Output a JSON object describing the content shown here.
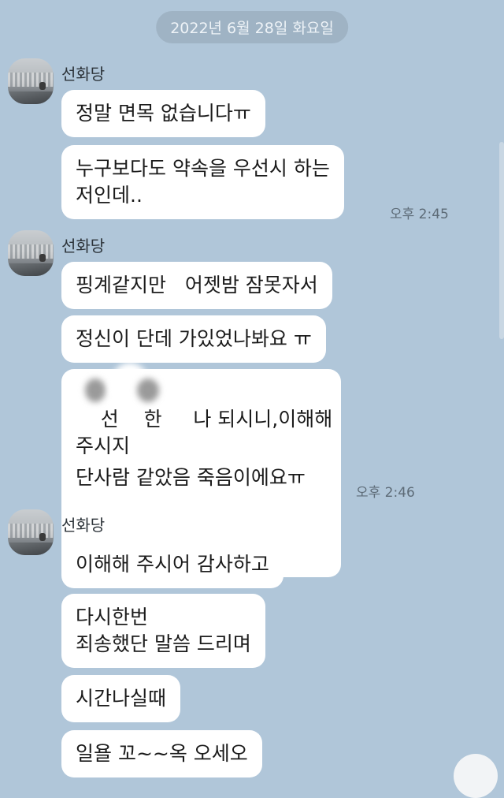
{
  "date_divider": "2022년 6월 28일 화요일",
  "groups": [
    {
      "sender": "선화당",
      "messages": [
        "정말 면목 없습니다ㅠ",
        "누구보다도 약속을 우선시 하는\n저인데.."
      ],
      "time": "오후 2:45"
    },
    {
      "sender": "선화당",
      "messages": [
        "핑계같지만   어젯밤 잠못자서",
        "정신이 단데 가있었나봐요 ㅠ",
        "선    한     나 되시니,이해해\n주시지",
        "단사람 같았음 죽음이에요ㅠ"
      ],
      "time": "오후 2:46"
    },
    {
      "sender": "선화당",
      "messages": [
        "이해해 주시어 감사하고",
        "다시한번\n죄송했단 말씀 드리며",
        "시간나실때",
        "일욜 꼬~~옥 오세오"
      ]
    }
  ]
}
